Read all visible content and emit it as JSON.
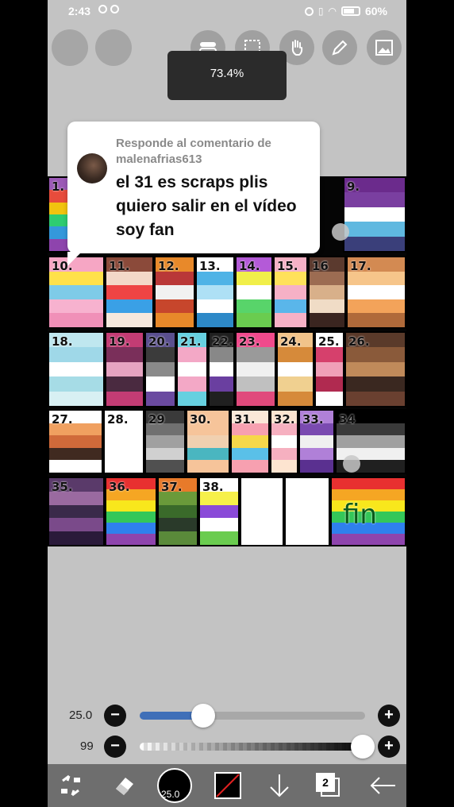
{
  "status_bar": {
    "time": "2:43",
    "battery": "60%"
  },
  "zoom": {
    "level": "73.4%"
  },
  "reply_bubble": {
    "reply_label": "Responde al comentario de malenafrias613",
    "comment": "el 31 es scraps plis quiero salir en el vídeo soy fan"
  },
  "canvas": {
    "cells": [
      {
        "label": "1.",
        "colors": [
          "#9b59b6",
          "#e74c3c",
          "#f1c40f",
          "#2ecc71",
          "#3498db",
          "#8e44ad"
        ]
      },
      {
        "label": "9.",
        "colors": [
          "#6b2b8c",
          "#7a3fa0",
          "#ffffff",
          "#5fb8e0",
          "#3a3f7a"
        ]
      },
      {
        "label": "10.",
        "colors": [
          "#f6a6c4",
          "#ffe14a",
          "#7ecbe8",
          "#f7b2cf",
          "#f090b8"
        ]
      },
      {
        "label": "11.",
        "colors": [
          "#8b4a3a",
          "#f3d8c8",
          "#e44",
          "#3aa0e6",
          "#f5e8dd"
        ]
      },
      {
        "label": "12.",
        "colors": [
          "#e8892a",
          "#b93838",
          "#f1f1f1",
          "#c7462c",
          "#e8892a"
        ]
      },
      {
        "label": "13.",
        "colors": [
          "#ffffff",
          "#4fb3e6",
          "#aee0f5",
          "#ffffff",
          "#2d89c8"
        ]
      },
      {
        "label": "14.",
        "colors": [
          "#b45ad8",
          "#f1ef4a",
          "#ffffff",
          "#58d46a",
          "#6acc4f"
        ]
      },
      {
        "label": "15.",
        "colors": [
          "#f6b1c6",
          "#ffe15a",
          "#f6b1c6",
          "#5ab6ea",
          "#f6b1c6"
        ]
      },
      {
        "label": "16",
        "colors": [
          "#5b3a2e",
          "#9c6c52",
          "#d8b08a",
          "#f0dcc6",
          "#3a2520"
        ]
      },
      {
        "label": "17.",
        "colors": [
          "#d38a52",
          "#f6c58a",
          "#ffffff",
          "#f3a35a",
          "#b06a3a"
        ]
      },
      {
        "label": "18.",
        "colors": [
          "#bfe7ef",
          "#9fd8e8",
          "#ffffff",
          "#a6dce6",
          "#d8f0f3"
        ]
      },
      {
        "label": "19.",
        "colors": [
          "#c33c74",
          "#7a2f5a",
          "#e6a3c1",
          "#4a2a40",
          "#c33c74"
        ]
      },
      {
        "label": "20.",
        "colors": [
          "#5a4f8e",
          "#3b3b3b",
          "#8a8a8a",
          "#ffffff",
          "#6a4aa0"
        ]
      },
      {
        "label": "21.",
        "colors": [
          "#66d0e0",
          "#f3a8c6",
          "#ffffff",
          "#f3a8c6",
          "#66d0e0"
        ]
      },
      {
        "label": "22.",
        "colors": [
          "#202020",
          "#888888",
          "#ffffff",
          "#6a3fa0",
          "#202020"
        ]
      },
      {
        "label": "23.",
        "colors": [
          "#f04a8c",
          "#9a9a9a",
          "#f0f0f0",
          "#c0c0c0",
          "#e04a7c"
        ]
      },
      {
        "label": "24.",
        "colors": [
          "#f1c38a",
          "#d68a3a",
          "#ffffff",
          "#f0d090",
          "#d68a3a"
        ]
      },
      {
        "label": "25.",
        "colors": [
          "#ffffff",
          "#d6406c",
          "#f0a0b8",
          "#b02a50",
          "#ffffff"
        ]
      },
      {
        "label": "26.",
        "colors": [
          "#5a3a2a",
          "#8a5a3a",
          "#c08a5a",
          "#3a2820",
          "#6a4030"
        ]
      },
      {
        "label": "27.",
        "colors": [
          "#ffffff",
          "#f0a060",
          "#d06a3a",
          "#402a20",
          "#ffffff"
        ]
      },
      {
        "label": "28.",
        "colors": [
          "#ffffff",
          "#ffffff",
          "#ffffff",
          "#ffffff"
        ]
      },
      {
        "label": "29",
        "colors": [
          "#3a3a3a",
          "#707070",
          "#a0a0a0",
          "#d0d0d0",
          "#505050"
        ]
      },
      {
        "label": "30.",
        "colors": [
          "#f6c49a",
          "#f6c49a",
          "#f0d0b0",
          "#4ab6c0",
          "#f6c49a"
        ]
      },
      {
        "label": "31.",
        "colors": [
          "#fbe8d8",
          "#f7a0b0",
          "#f6d84a",
          "#5ac0e8",
          "#f7a0b0"
        ]
      },
      {
        "label": "32.",
        "colors": [
          "#fde4d0",
          "#f6b0c0",
          "#ffffff",
          "#f6b0c0",
          "#fde4d0"
        ]
      },
      {
        "label": "33.",
        "colors": [
          "#b080d8",
          "#7a4ab0",
          "#f0f0f0",
          "#b080d8",
          "#5a3090"
        ]
      },
      {
        "label": "34",
        "colors": [
          "#000000",
          "#3a3a3a",
          "#a0a0a0",
          "#f0f0f0",
          "#202020"
        ]
      },
      {
        "label": "35.",
        "colors": [
          "#5a3a6a",
          "#9a6aa0",
          "#3a2a4a",
          "#7a4a8a",
          "#2a1a3a"
        ]
      },
      {
        "label": "36.",
        "colors": [
          "#e83030",
          "#f5a623",
          "#f8e71c",
          "#34c759",
          "#2f80ed",
          "#8e44ad"
        ]
      },
      {
        "label": "37.",
        "colors": [
          "#e87a2a",
          "#6a9a3a",
          "#3a6a2a",
          "#2a3a2a",
          "#5a8a3a"
        ]
      },
      {
        "label": "38.",
        "colors": [
          "#ffffff",
          "#f6f04a",
          "#8a4ad8",
          "#ffffff",
          "#6acc4f"
        ]
      },
      {
        "label": "",
        "colors": [
          "#ffffff",
          "#ffffff",
          "#ffffff",
          "#ffffff"
        ]
      },
      {
        "label": "",
        "colors": [
          "#ffffff",
          "#ffffff",
          "#ffffff",
          "#ffffff"
        ]
      },
      {
        "label": "fin",
        "colors": [
          "#e83030",
          "#f5a623",
          "#f8e71c",
          "#34c759",
          "#2f80ed",
          "#8e44ad"
        ]
      }
    ]
  },
  "brush_size": {
    "label": "25.0",
    "value_fraction": 0.28
  },
  "opacity": {
    "label": "99",
    "value_fraction": 0.99
  },
  "bottom_bar": {
    "brush_size_label": "25.0",
    "layers_count": "2"
  }
}
